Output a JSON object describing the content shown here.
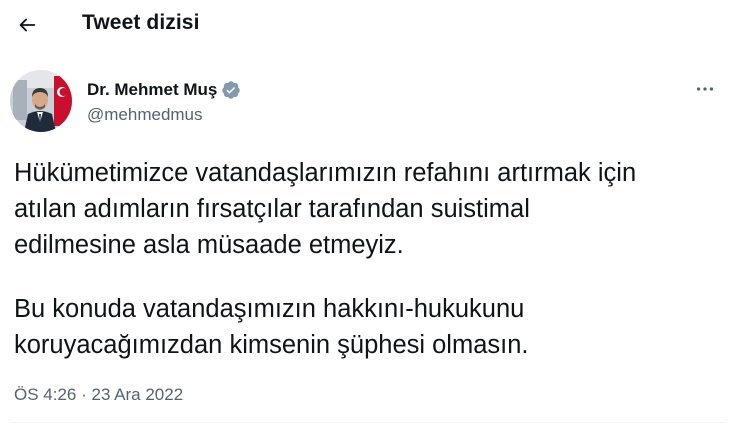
{
  "header": {
    "title": "Tweet dizisi"
  },
  "tweet": {
    "author_name": "Dr. Mehmet Muş",
    "author_handle": "@mehmedmus",
    "verified": true,
    "text_lines": [
      "Hükümetimizce vatandaşlarımızın refahını artırmak için",
      "atılan adımların fırsatçılar tarafından suistimal",
      "edilmesine asla müsaade etmeyiz.",
      "Bu konuda vatandaşımızın hakkını-hukukunu",
      "koruyacağımızdan kimsenin şüphesi olmasın."
    ],
    "time": "ÖS 4:26",
    "separator": " · ",
    "date": "23 Ara 2022"
  },
  "colors": {
    "text_primary": "#0f1419",
    "text_secondary": "#536471",
    "verified_badge": "#829aab",
    "background": "#ffffff"
  },
  "icons": {
    "back": "arrow-left-icon",
    "verified": "verified-badge-icon",
    "more": "more-horizontal-icon"
  }
}
